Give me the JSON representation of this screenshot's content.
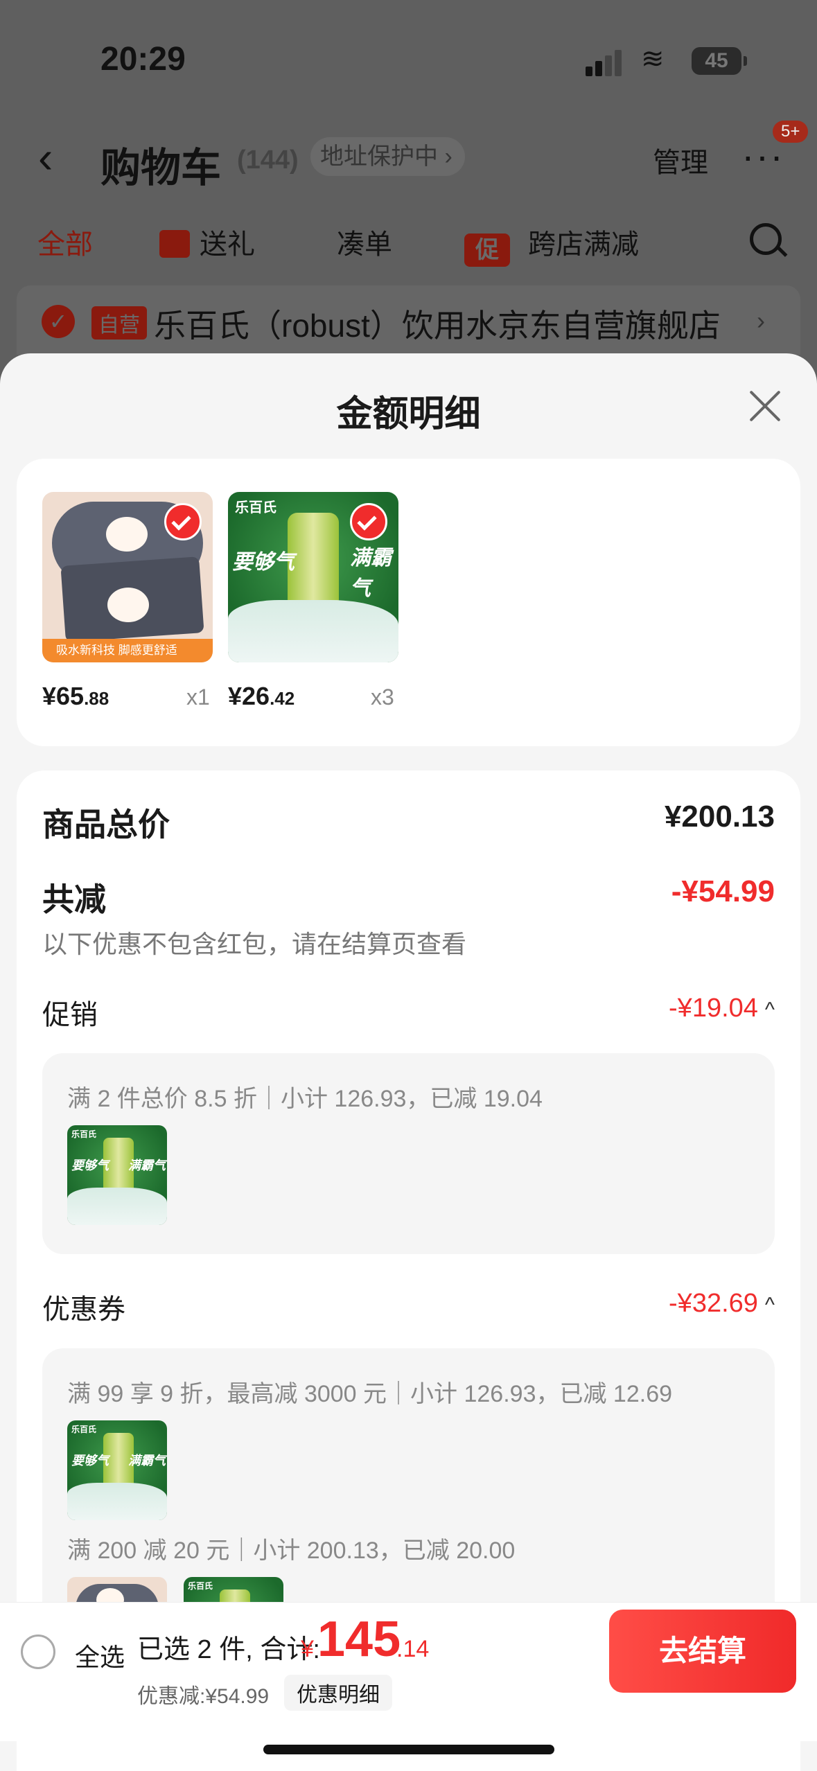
{
  "status": {
    "time": "20:29",
    "battery": "45"
  },
  "nav": {
    "title": "购物车",
    "count": "(144)",
    "address": "地址保护中 ›",
    "manage": "管理",
    "more_badge": "5+"
  },
  "tabs": [
    "全部",
    "送礼",
    "凑单",
    "跨店满减"
  ],
  "tab_icons": {
    "promo": "促"
  },
  "shop": {
    "badge": "自营",
    "name": "乐百氏（robust）饮用水京东自营旗舰店",
    "arrow": "›"
  },
  "sheet": {
    "title": "金额明细",
    "products": [
      {
        "name": "bath-mat",
        "price_int": "¥65",
        "price_dec": ".88",
        "qty": "x1",
        "strip": "吸水新科技 脚感更舒适"
      },
      {
        "name": "robust-soda",
        "price_int": "¥26",
        "price_dec": ".42",
        "qty": "x3",
        "brand": "乐百氏",
        "slogan_left": "要够气",
        "slogan_right": "满霸气"
      }
    ],
    "total_label": "商品总价",
    "total_value": "¥200.13",
    "reduce_label": "共减",
    "reduce_value": "-¥54.99",
    "reduce_note": "以下优惠不包含红包，请在结算页查看",
    "promo": {
      "label": "促销",
      "value": "-¥19.04",
      "rule": "满 2 件总价 8.5 折｜小计 126.93，已减 19.04"
    },
    "coupon": {
      "label": "优惠券",
      "value": "-¥32.69",
      "rule1": "满 99 享 9 折，最高减 3000 元｜小计 126.93，已减 12.69",
      "rule2": "满 200 减 20 元｜小计 200.13，已减 20.00"
    }
  },
  "bottom": {
    "select_all": "全选",
    "summary": "已选 2 件, 合计:",
    "currency": "¥",
    "total_int": "145",
    "total_dec": ".14",
    "discount": "优惠减:¥54.99",
    "discount_btn": "优惠明细",
    "checkout": "去结算"
  },
  "colors": {
    "accent": "#f02c2c",
    "sheet_bg": "#f5f5f5"
  }
}
